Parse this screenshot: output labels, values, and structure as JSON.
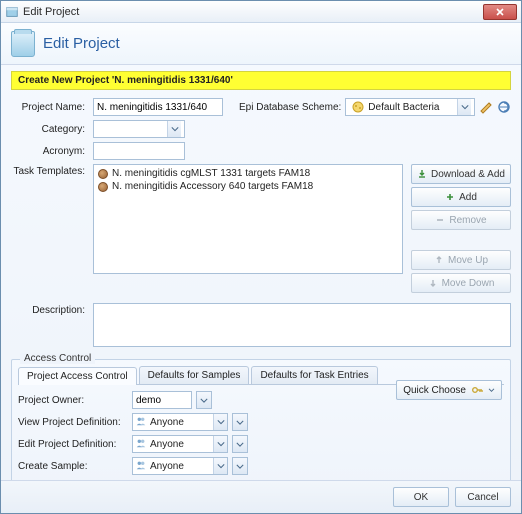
{
  "window": {
    "title": "Edit Project"
  },
  "header": {
    "title": "Edit Project"
  },
  "banner": {
    "text": "Create New Project 'N. meningitidis 1331/640'"
  },
  "labels": {
    "projectName": "Project Name:",
    "epiScheme": "Epi Database Scheme:",
    "category": "Category:",
    "acronym": "Acronym:",
    "taskTemplates": "Task Templates:",
    "description": "Description:",
    "accessControl": "Access Control",
    "projectOwner": "Project Owner:",
    "viewProjDef": "View Project Definition:",
    "editProjDef": "Edit Project Definition:",
    "createSample": "Create Sample:"
  },
  "fields": {
    "projectName": "N. meningitidis 1331/640",
    "epiScheme": "Default Bacteria",
    "category": "",
    "acronym": "",
    "description": ""
  },
  "taskTemplates": [
    "N. meningitidis cgMLST 1331 targets FAM18",
    "N. meningitidis Accessory 640 targets FAM18"
  ],
  "buttons": {
    "downloadAdd": "Download & Add",
    "add": "Add",
    "remove": "Remove",
    "moveUp": "Move Up",
    "moveDown": "Move Down",
    "quickChoose": "Quick Choose",
    "ok": "OK",
    "cancel": "Cancel"
  },
  "tabs": {
    "projectAccess": "Project Access Control",
    "defaultsSamples": "Defaults for Samples",
    "defaultsTasks": "Defaults for Task Entries"
  },
  "access": {
    "owner": "demo",
    "view": "Anyone",
    "edit": "Anyone",
    "create": "Anyone"
  }
}
